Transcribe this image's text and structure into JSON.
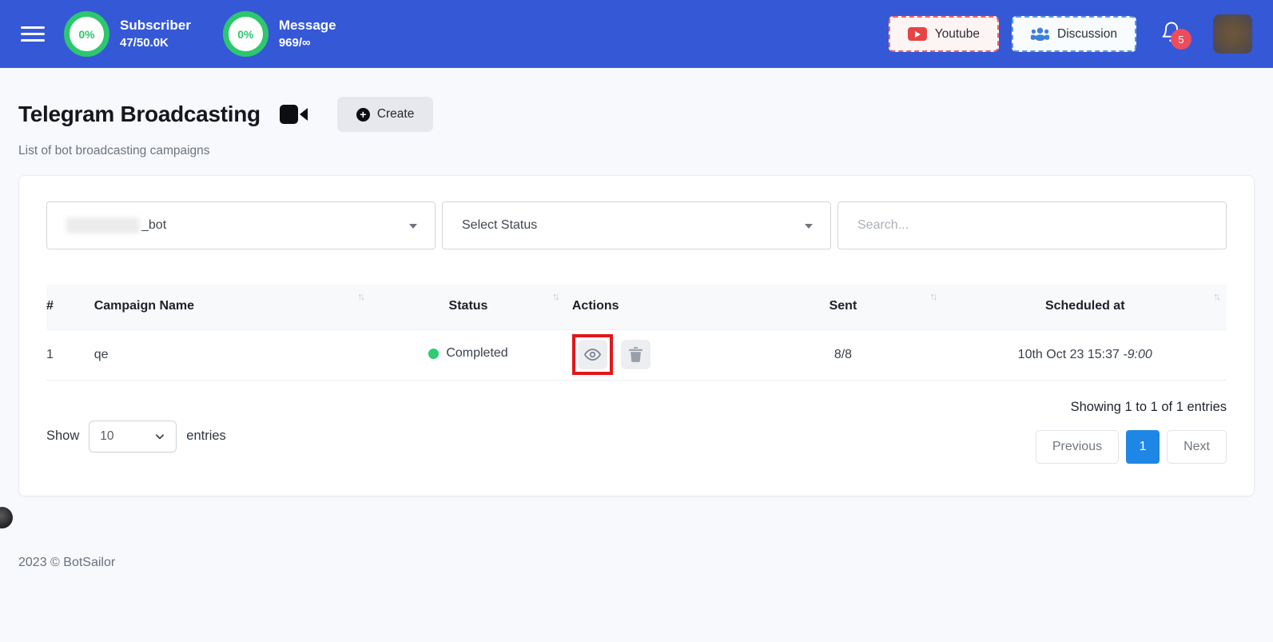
{
  "header": {
    "stats": [
      {
        "percent": "0%",
        "label": "Subscriber",
        "value": "47/50.0K"
      },
      {
        "percent": "0%",
        "label": "Message",
        "value": "969/∞"
      }
    ],
    "youtube_label": "Youtube",
    "discussion_label": "Discussion",
    "notification_count": "5"
  },
  "page": {
    "title": "Telegram Broadcasting",
    "subtitle": "List of bot broadcasting campaigns",
    "create_label": "Create"
  },
  "filters": {
    "bot_select_value": "_bot",
    "status_select_value": "Select Status",
    "search_placeholder": "Search..."
  },
  "table": {
    "columns": [
      "#",
      "Campaign Name",
      "Status",
      "Actions",
      "Sent",
      "Scheduled at"
    ],
    "rows": [
      {
        "index": "1",
        "name": "qe",
        "status": "Completed",
        "sent": "8/8",
        "scheduled_date": "10th Oct 23 15:37",
        "scheduled_offset": "-9:00"
      }
    ]
  },
  "table_footer": {
    "show_label": "Show",
    "page_size": "10",
    "entries_label": "entries",
    "showing_text": "Showing 1 to 1 of 1 entries"
  },
  "pagination": {
    "previous_label": "Previous",
    "current_page": "1",
    "next_label": "Next"
  },
  "footer": {
    "copyright": "2023 © BotSailor"
  },
  "icons": {
    "sort": "↑↓"
  },
  "colors": {
    "header_blue": "#3558d6",
    "progress_green": "#2dc76d",
    "status_green": "#2ecc71",
    "badge_red": "#ed4c5c",
    "annotation_red": "#e3161c",
    "active_page_blue": "#1e87e5",
    "youtube_red": "#e64444",
    "discussion_blue": "#3d7fd9"
  }
}
